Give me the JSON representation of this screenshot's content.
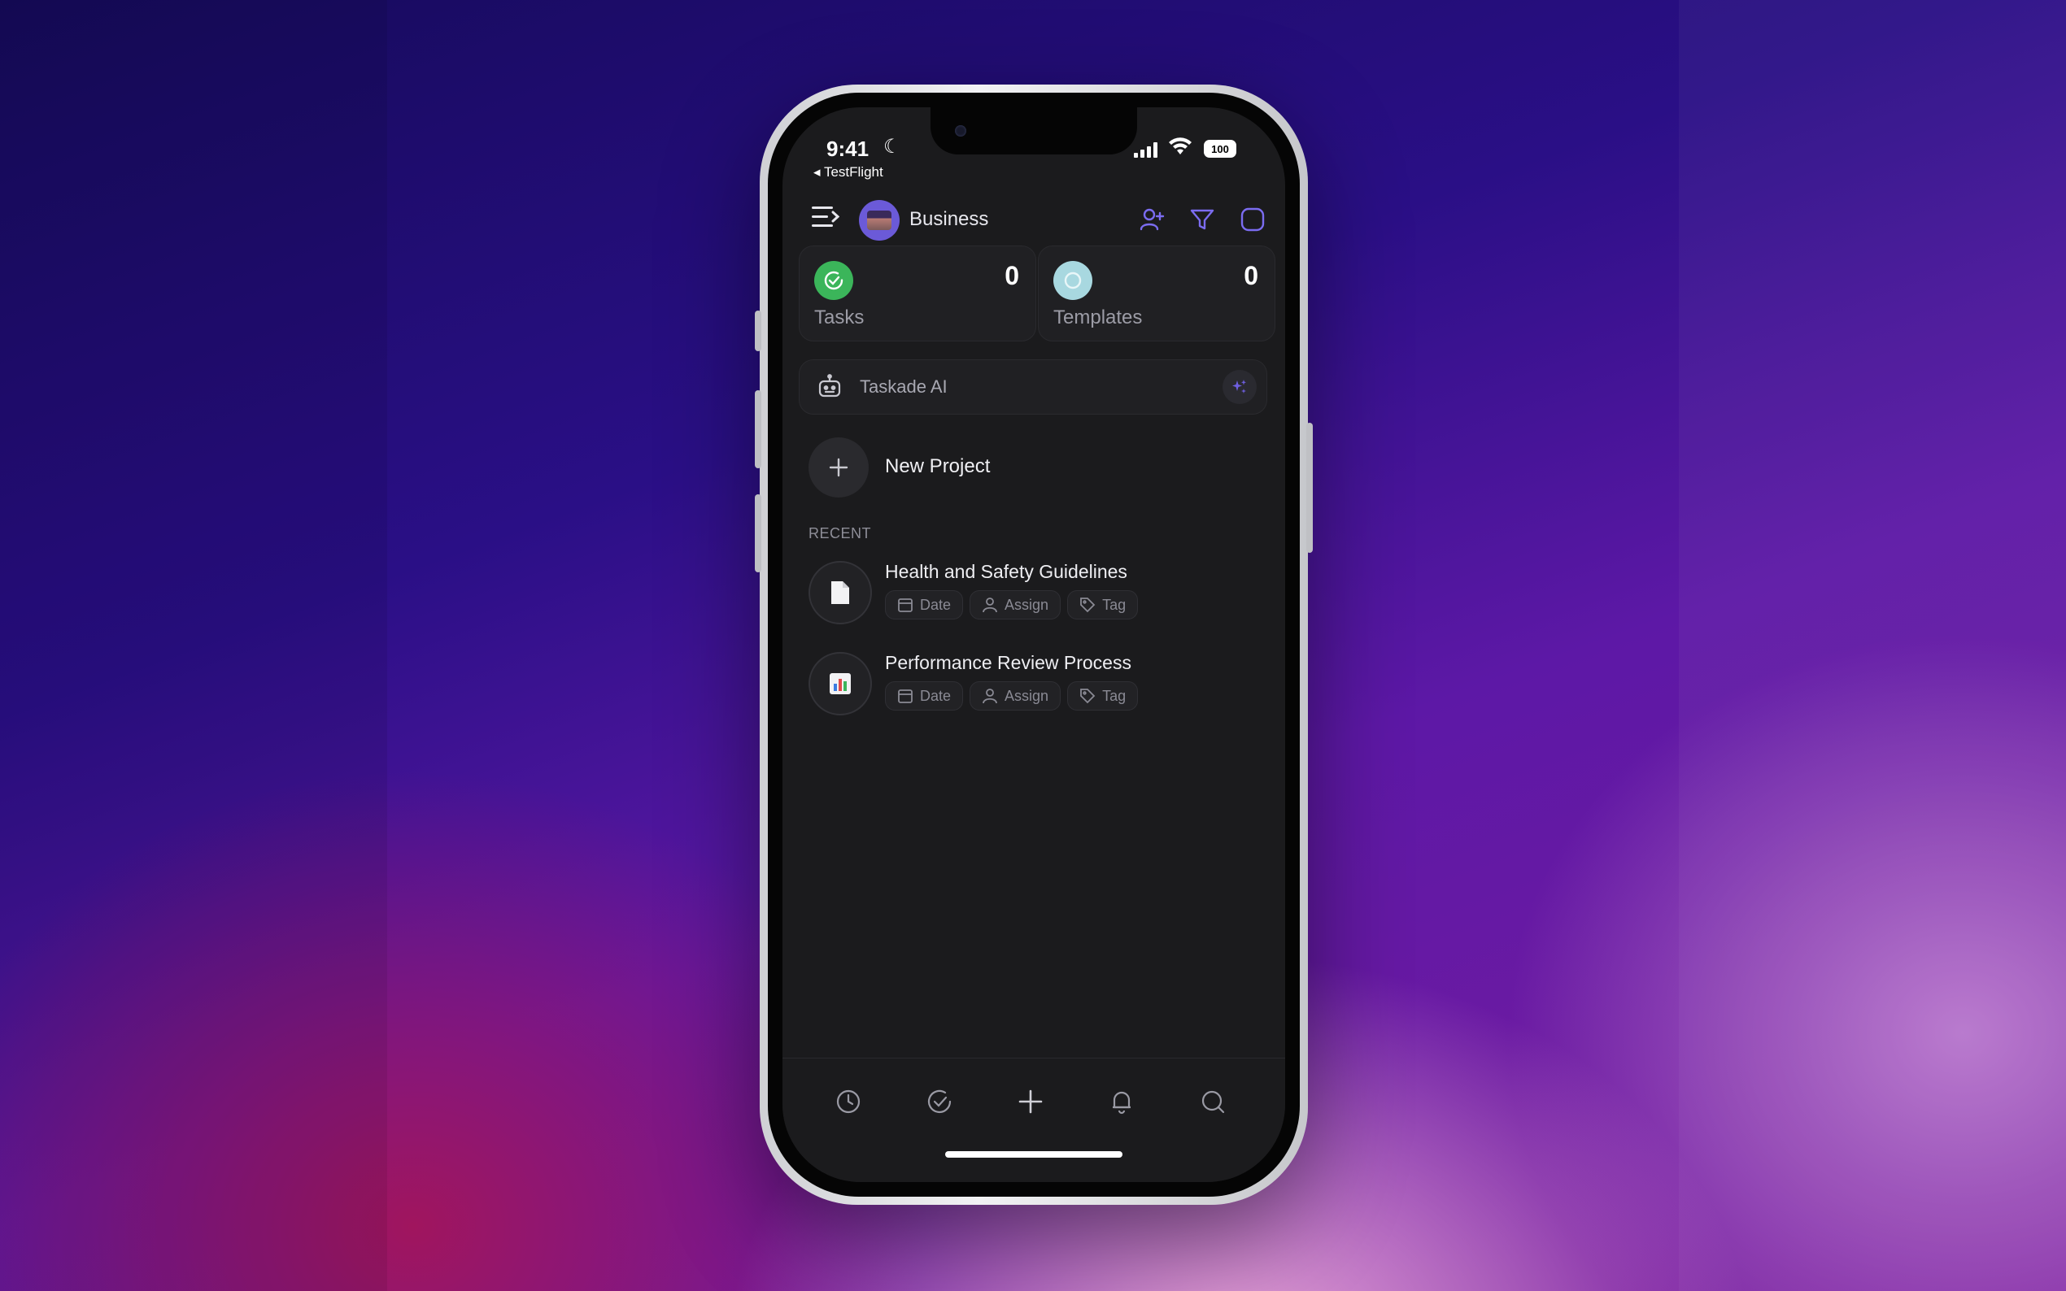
{
  "status_bar": {
    "time": "9:41",
    "back_app": "◂ TestFlight",
    "battery": "100"
  },
  "header": {
    "workspace_name": "Business"
  },
  "stats": [
    {
      "label": "Tasks",
      "count": "0",
      "color": "#3bb55a"
    },
    {
      "label": "Templates",
      "count": "0",
      "color": "#a8d8e0"
    }
  ],
  "ai": {
    "label": "Taskade AI"
  },
  "new_project": {
    "label": "New Project"
  },
  "recent": {
    "heading": "RECENT",
    "items": [
      {
        "title": "Health and Safety Guidelines",
        "icon": "document-icon",
        "chips": [
          "Date",
          "Assign",
          "Tag"
        ]
      },
      {
        "title": "Performance Review Process",
        "icon": "bar-chart-icon",
        "chips": [
          "Date",
          "Assign",
          "Tag"
        ]
      }
    ]
  },
  "tabbar": {
    "icons": [
      "clock-icon",
      "check-circle-icon",
      "plus-icon",
      "bell-icon",
      "search-icon"
    ]
  },
  "colors": {
    "accent": "#6b5ad8",
    "screen_bg": "#1b1b1d"
  }
}
